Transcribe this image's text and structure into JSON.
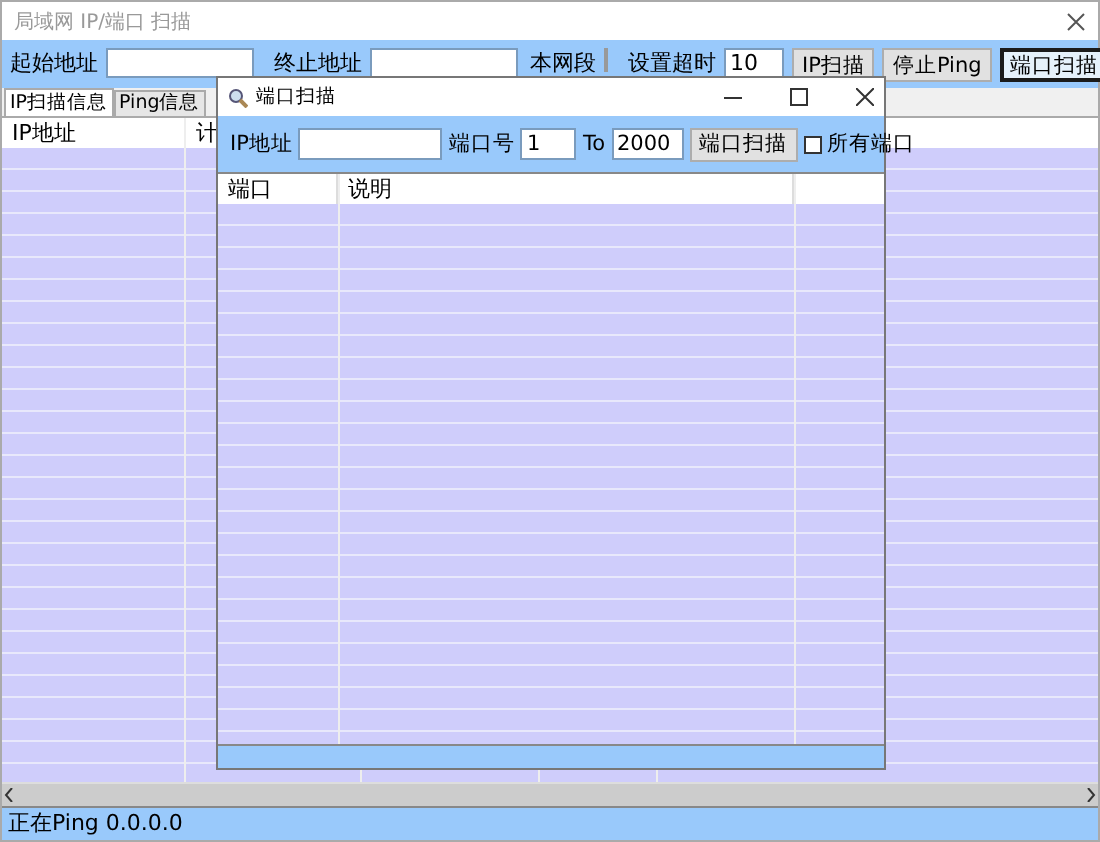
{
  "window": {
    "title": "局域网 IP/端口 扫描"
  },
  "toolbar": {
    "start_label": "起始地址",
    "end_label": "终止地址",
    "segment_label": "本网段",
    "timeout_label": "设置超时",
    "timeout_value": "10",
    "buttons": [
      {
        "label": "IP扫描",
        "default": false
      },
      {
        "label": "停止Ping",
        "default": false
      },
      {
        "label": "端口扫描",
        "default": true
      }
    ]
  },
  "tabs": [
    {
      "label": "IP扫描信息",
      "selected": true
    },
    {
      "label": "Ping信息",
      "selected": false
    }
  ],
  "table": {
    "columns": [
      "IP地址",
      "计"
    ]
  },
  "status_bar": "正在Ping 0.0.0.0",
  "dialog": {
    "title": "端口扫描",
    "ip_label": "IP地址",
    "port_label": "端口号",
    "port_from": "1",
    "to_label": "To",
    "port_to": "2000",
    "scan_button": "端口扫描",
    "all_ports": {
      "label": "所有端口",
      "checked": false
    },
    "columns": [
      "端口",
      "说明"
    ]
  }
}
